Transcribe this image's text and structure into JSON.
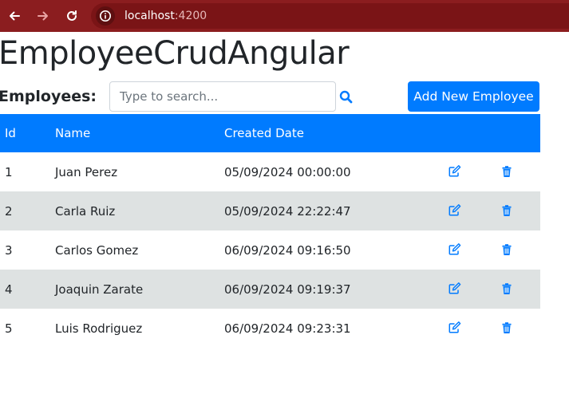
{
  "browser": {
    "url_host": "localhost",
    "url_port": ":4200"
  },
  "page": {
    "title": "EmployeeCrudAngular",
    "employees_label": "Employees:",
    "search_placeholder": "Type to search...",
    "add_button_label": "Add New Employee"
  },
  "table": {
    "headers": {
      "id": "Id",
      "name": "Name",
      "created": "Created Date"
    },
    "rows": [
      {
        "id": "1",
        "name": "Juan Perez",
        "created": "05/09/2024 00:00:00"
      },
      {
        "id": "2",
        "name": "Carla Ruiz",
        "created": "05/09/2024 22:22:47"
      },
      {
        "id": "3",
        "name": "Carlos Gomez",
        "created": "06/09/2024 09:16:50"
      },
      {
        "id": "4",
        "name": "Joaquin Zarate",
        "created": "06/09/2024 09:19:37"
      },
      {
        "id": "5",
        "name": "Luis Rodriguez",
        "created": "06/09/2024 09:23:31"
      }
    ]
  },
  "icons": {
    "back": "arrow-left-icon",
    "forward": "arrow-right-icon",
    "reload": "reload-icon",
    "site_info": "info-icon",
    "search": "search-icon",
    "edit": "edit-icon",
    "delete": "trash-icon"
  },
  "colors": {
    "browser_bar": "#8b1d1f",
    "primary": "#007bff",
    "row_alt": "#dee2e2",
    "text": "#212529"
  }
}
